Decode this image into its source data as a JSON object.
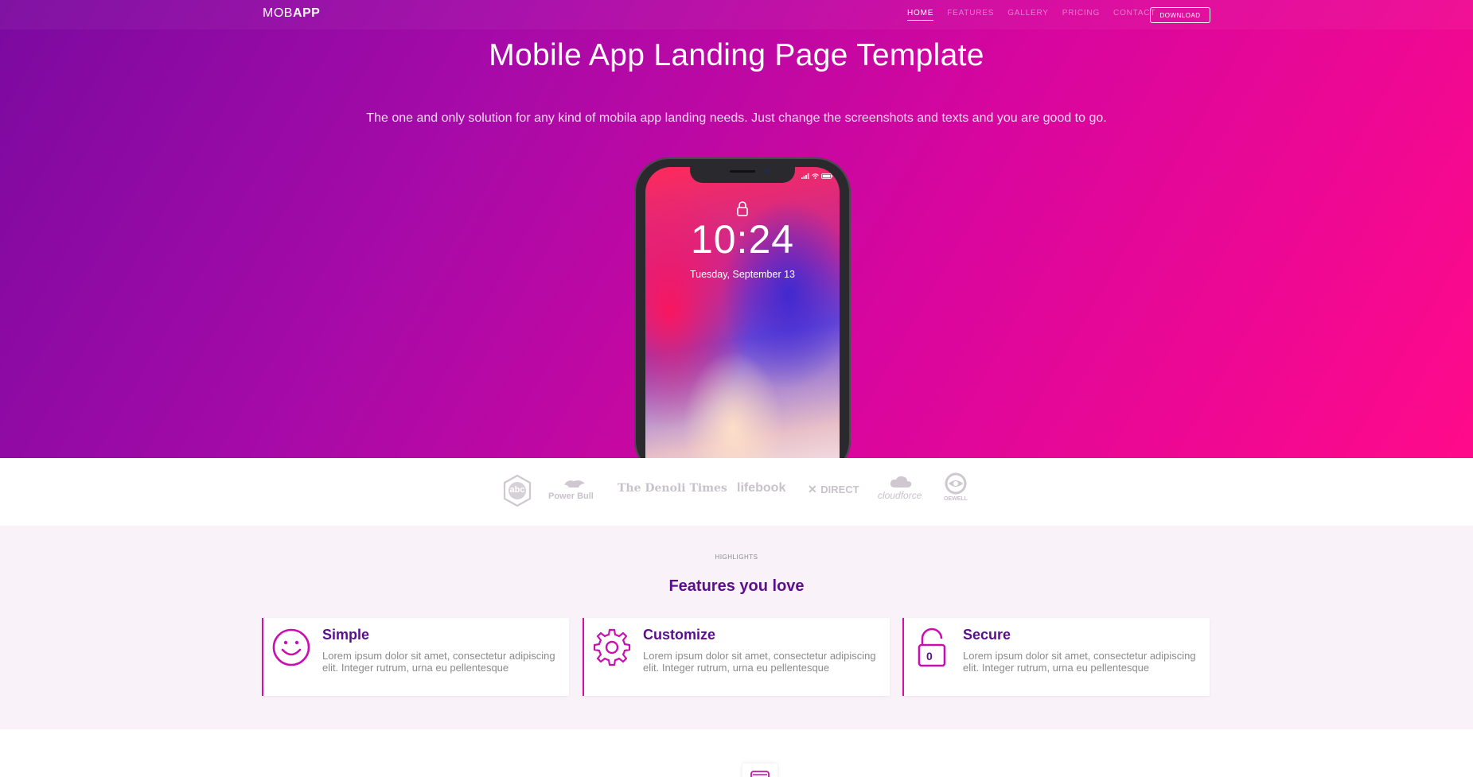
{
  "header": {
    "brand_light": "MOB",
    "brand_bold": "APP",
    "nav": [
      "HOME",
      "FEATURES",
      "GALLERY",
      "PRICING",
      "CONTACT"
    ],
    "active_nav": "HOME",
    "download_label": "DOWNLOAD"
  },
  "hero": {
    "title": "Mobile App Landing Page Template",
    "subtitle": "The one and only solution for any kind of mobila app landing needs. Just change the screenshots and texts and you are good to go.",
    "phone": {
      "time": "10:24",
      "date": "Tuesday, September 13"
    }
  },
  "logos": [
    {
      "text": "abc",
      "icon": "hexagon-logo"
    },
    {
      "text": "Power Bull",
      "icon": "bull-logo"
    },
    {
      "text": "The Denoli Times",
      "icon": ""
    },
    {
      "text": "lifebook",
      "icon": ""
    },
    {
      "text": "DIRECT",
      "icon": "x-logo"
    },
    {
      "text": "cloudforce",
      "icon": "cloud-logo"
    },
    {
      "text": "OEWELL",
      "icon": "eye-logo"
    }
  ],
  "features": {
    "eyebrow": "HIGHLIGHTS",
    "title": "Features you love",
    "cards": [
      {
        "icon": "smiley-icon",
        "title": "Simple",
        "text": "Lorem ipsum dolor sit amet, consectetur adipiscing elit. Integer rutrum, urna eu pellentesque"
      },
      {
        "icon": "gear-icon",
        "title": "Customize",
        "text": "Lorem ipsum dolor sit amet, consectetur adipiscing elit. Integer rutrum, urna eu pellentesque"
      },
      {
        "icon": "lock-icon",
        "title": "Secure",
        "text": "Lorem ipsum dolor sit amet, consectetur adipiscing elit. Integer rutrum, urna eu pellentesque"
      }
    ],
    "lock_digit": "0"
  },
  "colors": {
    "accent": "#d410a6",
    "title_purple": "#5b0f8c",
    "gradient_start": "#7b0aa0",
    "gradient_end": "#ff0a8a"
  }
}
